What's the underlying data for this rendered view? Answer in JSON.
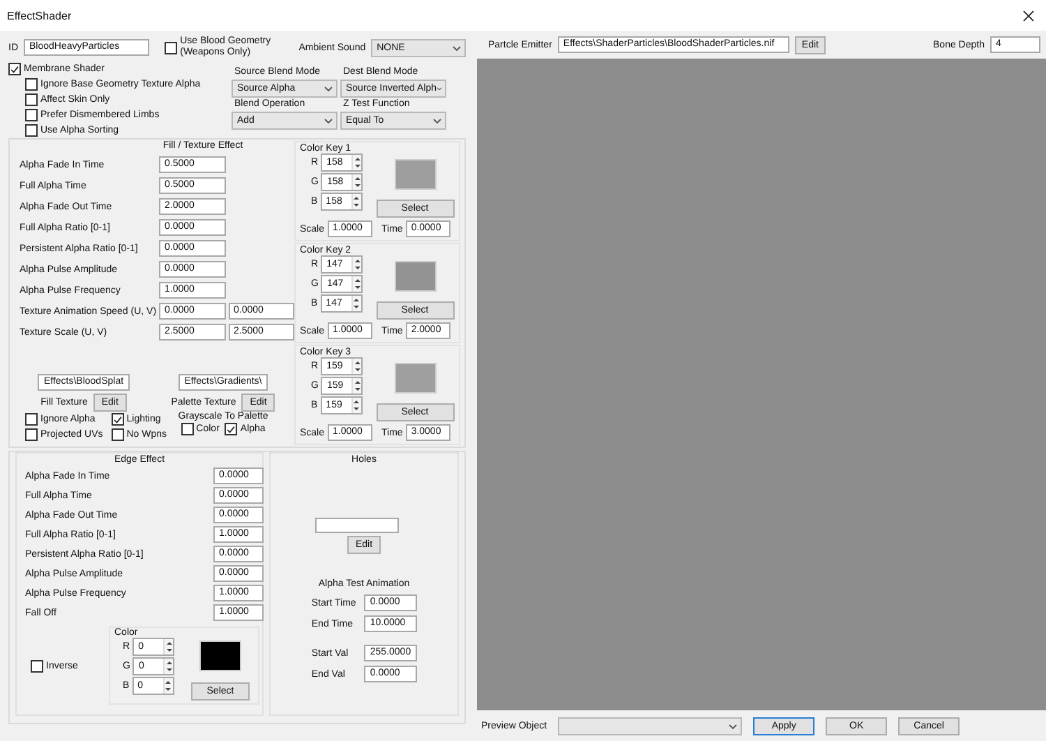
{
  "window": {
    "title": "EffectShader"
  },
  "id_field": {
    "label": "ID",
    "value": "BloodHeavyParticles"
  },
  "blood_geometry": {
    "label": "Use Blood Geometry (Weapons Only)",
    "checked": false
  },
  "ambient_sound": {
    "label": "Ambient Sound",
    "value": "NONE"
  },
  "membrane_shader": {
    "label": "Membrane Shader",
    "checked": true
  },
  "membrane_options": [
    {
      "label": "Ignore Base Geometry Texture Alpha",
      "checked": false
    },
    {
      "label": "Affect Skin Only",
      "checked": false
    },
    {
      "label": "Prefer Dismembered Limbs",
      "checked": false
    },
    {
      "label": "Use Alpha Sorting",
      "checked": false
    }
  ],
  "blend": [
    {
      "label": "Source Blend Mode",
      "value": "Source Alpha"
    },
    {
      "label": "Dest Blend Mode",
      "value": "Source Inverted Alph"
    },
    {
      "label": "Blend Operation",
      "value": "Add"
    },
    {
      "label": "Z Test Function",
      "value": "Equal To"
    }
  ],
  "fill_texture_effect": {
    "title": "Fill / Texture Effect",
    "fields": [
      {
        "label": "Alpha Fade In Time",
        "values": [
          "0.5000"
        ]
      },
      {
        "label": "Full Alpha Time",
        "values": [
          "0.5000"
        ]
      },
      {
        "label": "Alpha Fade Out Time",
        "values": [
          "2.0000"
        ]
      },
      {
        "label": "Full Alpha Ratio [0-1]",
        "values": [
          "0.0000"
        ]
      },
      {
        "label": "Persistent Alpha Ratio [0-1]",
        "values": [
          "0.0000"
        ]
      },
      {
        "label": "Alpha Pulse Amplitude",
        "values": [
          "0.0000"
        ]
      },
      {
        "label": "Alpha Pulse Frequency",
        "values": [
          "1.0000"
        ]
      },
      {
        "label": "Texture Animation Speed (U, V)",
        "values": [
          "0.0000",
          "0.0000"
        ]
      },
      {
        "label": "Texture Scale (U, V)",
        "values": [
          "2.5000",
          "2.5000"
        ]
      }
    ],
    "color_keys": [
      {
        "title": "Color Key 1",
        "channels": [
          {
            "label": "R",
            "value": "158"
          },
          {
            "label": "G",
            "value": "158"
          },
          {
            "label": "B",
            "value": "158"
          }
        ],
        "select": "Select",
        "scale_label": "Scale",
        "scale": "1.0000",
        "time_label": "Time",
        "time": "0.0000"
      },
      {
        "title": "Color Key 2",
        "channels": [
          {
            "label": "R",
            "value": "147"
          },
          {
            "label": "G",
            "value": "147"
          },
          {
            "label": "B",
            "value": "147"
          }
        ],
        "select": "Select",
        "scale_label": "Scale",
        "scale": "1.0000",
        "time_label": "Time",
        "time": "2.0000"
      },
      {
        "title": "Color Key 3",
        "channels": [
          {
            "label": "R",
            "value": "159"
          },
          {
            "label": "G",
            "value": "159"
          },
          {
            "label": "B",
            "value": "159"
          }
        ],
        "select": "Select",
        "scale_label": "Scale",
        "scale": "1.0000",
        "time_label": "Time",
        "time": "3.0000"
      }
    ],
    "textures": [
      {
        "value": "Effects\\BloodSplat",
        "label": "Fill Texture",
        "edit": "Edit"
      },
      {
        "value": "Effects\\Gradients\\",
        "label": "Palette Texture",
        "edit": "Edit"
      }
    ],
    "options": [
      {
        "label": "Ignore Alpha",
        "checked": false
      },
      {
        "label": "Lighting",
        "checked": true
      },
      {
        "label": "Projected UVs",
        "checked": false
      },
      {
        "label": "No Wpns",
        "checked": false
      }
    ],
    "grayscale": {
      "label": "Grayscale To Palette",
      "options": [
        {
          "label": "Color",
          "checked": false
        },
        {
          "label": "Alpha",
          "checked": true
        }
      ]
    }
  },
  "edge_effect": {
    "title": "Edge Effect",
    "fields": [
      {
        "label": "Alpha Fade In Time",
        "values": [
          "0.0000"
        ]
      },
      {
        "label": "Full Alpha Time",
        "values": [
          "0.0000"
        ]
      },
      {
        "label": "Alpha Fade Out Time",
        "values": [
          "0.0000"
        ]
      },
      {
        "label": "Full Alpha Ratio [0-1]",
        "values": [
          "1.0000"
        ]
      },
      {
        "label": "Persistent Alpha Ratio [0-1]",
        "values": [
          "0.0000"
        ]
      },
      {
        "label": "Alpha Pulse Amplitude",
        "values": [
          "0.0000"
        ]
      },
      {
        "label": "Alpha Pulse Frequency",
        "values": [
          "1.0000"
        ]
      },
      {
        "label": "Fall Off",
        "values": [
          "1.0000"
        ]
      }
    ],
    "inverse": {
      "label": "Inverse",
      "checked": false
    },
    "color": {
      "title": "Color",
      "channels": [
        {
          "label": "R",
          "value": "0"
        },
        {
          "label": "G",
          "value": "0"
        },
        {
          "label": "B",
          "value": "0"
        }
      ],
      "select": "Select"
    }
  },
  "holes": {
    "title": "Holes",
    "edit": "Edit",
    "alpha_test_animation": {
      "title": "Alpha Test Animation",
      "fields": [
        {
          "label": "Start Time",
          "value": "0.0000"
        },
        {
          "label": "End Time",
          "value": "10.0000"
        },
        {
          "label": "Start Val",
          "value": "255.0000"
        },
        {
          "label": "End Val",
          "value": "0.0000"
        }
      ]
    }
  },
  "particle_emitter": {
    "label": "Partcle Emitter",
    "value": "Effects\\ShaderParticles\\BloodShaderParticles.nif",
    "edit": "Edit"
  },
  "bone_depth": {
    "label": "Bone Depth",
    "value": "4"
  },
  "preview_object": {
    "label": "Preview Object"
  },
  "buttons": [
    {
      "label": "Apply",
      "default": true
    },
    {
      "label": "OK",
      "default": false
    },
    {
      "label": "Cancel",
      "default": false
    }
  ]
}
